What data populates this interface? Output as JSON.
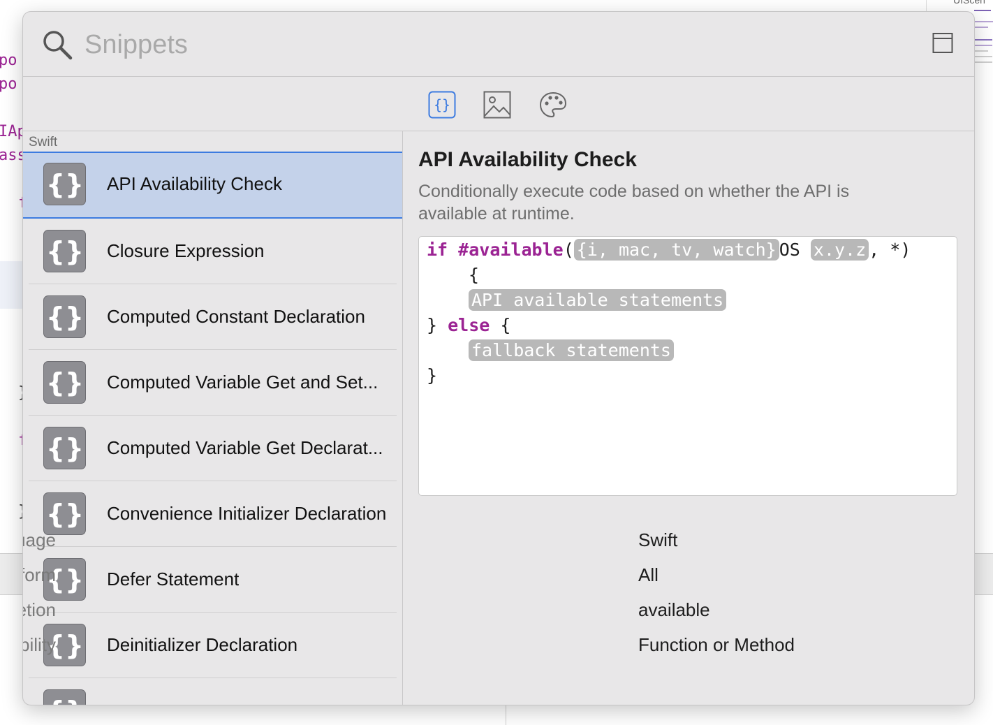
{
  "background": {
    "minimap_label": "UIScen",
    "code_fragments": [
      "po",
      "po",
      "IAp",
      "ass",
      "f",
      "}",
      "f",
      "}"
    ]
  },
  "search": {
    "placeholder": "Snippets",
    "value": ""
  },
  "tabs": [
    {
      "name": "snippets",
      "icon": "braces-icon",
      "active": true
    },
    {
      "name": "media",
      "icon": "image-icon",
      "active": false
    },
    {
      "name": "colors",
      "icon": "palette-icon",
      "active": false
    }
  ],
  "list": {
    "section": "Swift",
    "items": [
      {
        "label": "API Availability Check",
        "selected": true
      },
      {
        "label": "Closure Expression",
        "selected": false
      },
      {
        "label": "Computed Constant Declaration",
        "selected": false
      },
      {
        "label": "Computed Variable Get and Set...",
        "selected": false
      },
      {
        "label": "Computed Variable Get Declarat...",
        "selected": false
      },
      {
        "label": "Convenience Initializer Declaration",
        "selected": false
      },
      {
        "label": "Defer Statement",
        "selected": false
      },
      {
        "label": "Deinitializer Declaration",
        "selected": false
      },
      {
        "label": "",
        "selected": false
      }
    ]
  },
  "detail": {
    "title": "API Availability Check",
    "description": "Conditionally execute code based on whether the API is available at runtime.",
    "code": {
      "kw_if": "if",
      "kw_available": "#available",
      "paren_open": "(",
      "ph_platforms": "{i, mac, tv, watch}",
      "os_text": "OS",
      "ph_version": "x.y.z",
      "line1_tail": ", *)",
      "line2": "{",
      "ph_api": "API available statements",
      "line4_close": "}",
      "kw_else": "else",
      "line4_tail": "{",
      "ph_fallback": "fallback statements",
      "line6": "}"
    },
    "meta": [
      {
        "label": "Language",
        "value": "Swift"
      },
      {
        "label": "Platform",
        "value": "All"
      },
      {
        "label": "Completion",
        "value": "available"
      },
      {
        "label": "Availability",
        "value": "Function or Method"
      }
    ]
  },
  "colors": {
    "accent": "#3c7be0",
    "selection": "#c4d2ea",
    "keyword": "#9b2393",
    "placeholder_token": "#b8b8b8"
  }
}
